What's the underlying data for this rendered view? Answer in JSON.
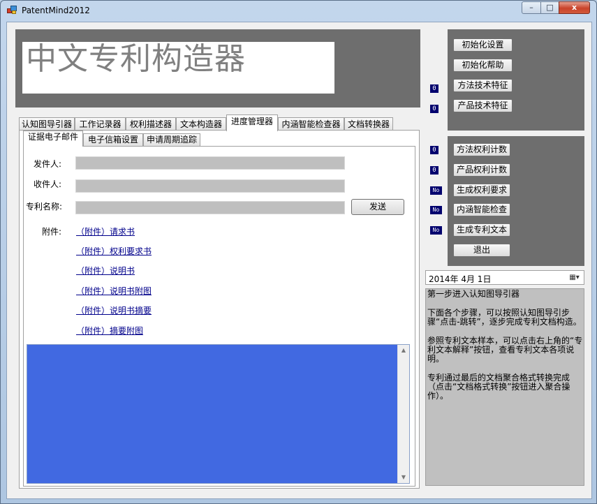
{
  "window": {
    "title": "PatentMind2012",
    "controls": {
      "min": "–",
      "max": "□",
      "close": "x"
    }
  },
  "banner": {
    "title": "中文专利构造器"
  },
  "main_tabs": [
    "认知图导引器",
    "工作记录器",
    "权利描述器",
    "文本构造器",
    "进度管理器",
    "内涵智能检查器",
    "文档转换器"
  ],
  "active_main_tab": "进度管理器",
  "sub_tabs": [
    "证据电子邮件",
    "电子信箱设置",
    "申请周期追踪"
  ],
  "active_sub_tab": "证据电子邮件",
  "email": {
    "sender_label": "发件人:",
    "sender_value": "",
    "recipient_label": "收件人:",
    "recipient_value": "",
    "patent_name_label": "专利名称:",
    "patent_name_value": "",
    "send_button": "发送",
    "attachments_label": "附件:",
    "attachments": [
      "（附件）请求书",
      "（附件）权利要求书",
      "（附件）说明书",
      "（附件）说明书附图",
      "（附件）说明书摘要",
      "（附件）摘要附图"
    ],
    "memo_text": "",
    "memo_color": "#4169e1"
  },
  "side_panel": {
    "top_buttons": [
      "初始化设置",
      "初始化帮助",
      "方法技术特征",
      "产品技术特征"
    ],
    "top_indicators": [
      "0",
      "0"
    ],
    "bottom_buttons": [
      "方法权利计数",
      "产品权利计数",
      "生成权利要求",
      "内涵智能检查",
      "生成专利文本",
      "退出"
    ],
    "bottom_indicators": [
      "0",
      "0",
      "No",
      "No",
      "No"
    ]
  },
  "date_picker": {
    "value": "2014年  4月  1日",
    "icon": "calendar-dropdown-icon"
  },
  "guide": {
    "paragraphs": [
      "第一步进入认知图导引器",
      "下面各个步骤，可以按照认知图导引步骤“点击-跳转”，逐步完成专利文档构造。",
      "参照专利文本样本，可以点击右上角的“专利文本解释”按钮，查看专利文本各项说明。",
      "专利通过最后的文档聚合格式转换完成（点击“文档格式转换”按钮进入聚合操作）。"
    ]
  },
  "colors": {
    "panel_bg": "#6e6e6e",
    "indicator_bg": "#00006e",
    "guide_bg": "#c0c0c0",
    "field_bg": "#bfbfbf"
  }
}
